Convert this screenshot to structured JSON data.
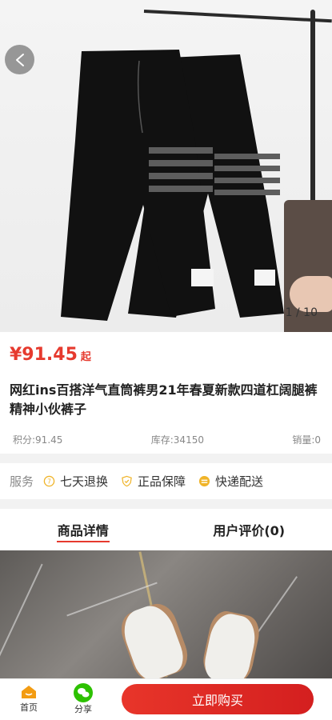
{
  "gallery": {
    "counter": "1 / 10"
  },
  "product": {
    "price": "¥91.45",
    "price_suffix": "起",
    "title": "网红ins百搭洋气直筒裤男21年春夏新款四道杠阔腿裤精神小伙裤子",
    "points": "积分:91.45",
    "stock": "库存:34150",
    "sales": "销量:0"
  },
  "service": {
    "label": "服务",
    "items": [
      "七天退换",
      "正品保障",
      "快递配送"
    ]
  },
  "tabs": [
    {
      "label": "商品详情",
      "active": true
    },
    {
      "label": "用户评价(0)",
      "active": false
    }
  ],
  "bottom_bar": {
    "home_label": "首页",
    "share_label": "分享",
    "buy_label": "立即购买"
  },
  "colors": {
    "accent": "#e63a2e",
    "service_icon": "#f0b429",
    "share_green": "#2dc100"
  }
}
